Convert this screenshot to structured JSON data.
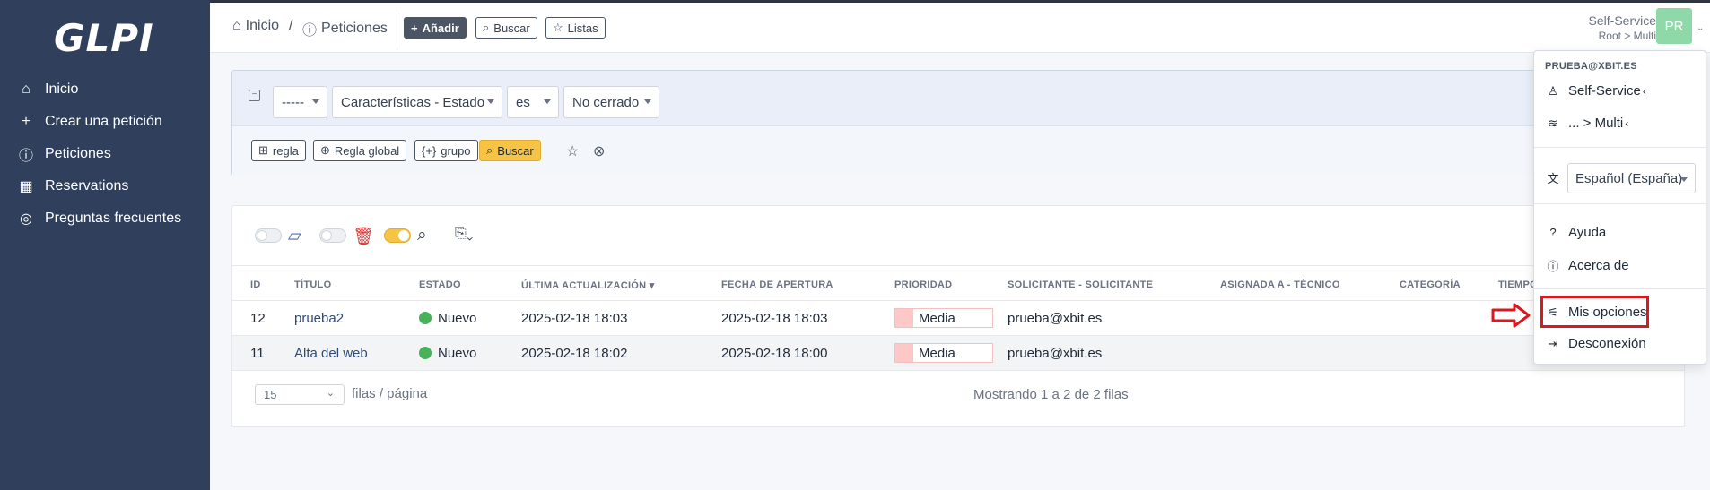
{
  "app": {
    "logo": "GLPI"
  },
  "sidebar": {
    "items": [
      {
        "label": "Inicio",
        "icon": "home-icon"
      },
      {
        "label": "Crear una petición",
        "icon": "plus-icon"
      },
      {
        "label": "Peticiones",
        "icon": "alert-circle-icon"
      },
      {
        "label": "Reservations",
        "icon": "calendar-icon"
      },
      {
        "label": "Preguntas frecuentes",
        "icon": "lifebuoy-icon"
      }
    ]
  },
  "header": {
    "breadcrumb": {
      "home": "Inicio",
      "separator": "/",
      "current": "Peticiones"
    },
    "buttons": {
      "add": "Añadir",
      "search": "Buscar",
      "lists": "Listas"
    },
    "profile": {
      "name": "Self-Service",
      "entity": "Root > Multi",
      "initials": "PR"
    }
  },
  "search": {
    "field_select": "-----",
    "criteria_select": "Características - Estado",
    "operator_select": "es",
    "value_select": "No cerrado",
    "buttons": {
      "rule": "regla",
      "global_rule": "Regla global",
      "group": "grupo",
      "search": "Buscar"
    }
  },
  "table": {
    "headers": [
      "ID",
      "TÍTULO",
      "ESTADO",
      "ÚLTIMA ACTUALIZACIÓN",
      "FECHA DE APERTURA",
      "PRIORIDAD",
      "SOLICITANTE - SOLICITANTE",
      "ASIGNADA A - TÉCNICO",
      "CATEGORÍA",
      "TIEMPO"
    ],
    "rows": [
      {
        "id": "12",
        "title": "prueba2",
        "status": "Nuevo",
        "updated": "2025-02-18 18:03",
        "opened": "2025-02-18 18:03",
        "priority": "Media",
        "requester": "prueba@xbit.es"
      },
      {
        "id": "11",
        "title": "Alta del web",
        "status": "Nuevo",
        "updated": "2025-02-18 18:02",
        "opened": "2025-02-18 18:00",
        "priority": "Media",
        "requester": "prueba@xbit.es"
      }
    ],
    "pagination": {
      "rows_per_page": "15",
      "rows_label": "filas / página",
      "showing": "Mostrando 1 a 2 de 2 filas"
    }
  },
  "user_menu": {
    "email": "PRUEBA@XBIT.ES",
    "profile": "Self-Service",
    "entity": "... > Multi",
    "language": "Español (España)",
    "help": "Ayuda",
    "about": "Acerca de",
    "my_options": "Mis opciones",
    "logout": "Desconexión"
  },
  "colors": {
    "sidebar": "#2f3f5c",
    "accent_yellow": "#f6c344",
    "status_new": "#48b25a",
    "annotation_red": "#d71920"
  }
}
